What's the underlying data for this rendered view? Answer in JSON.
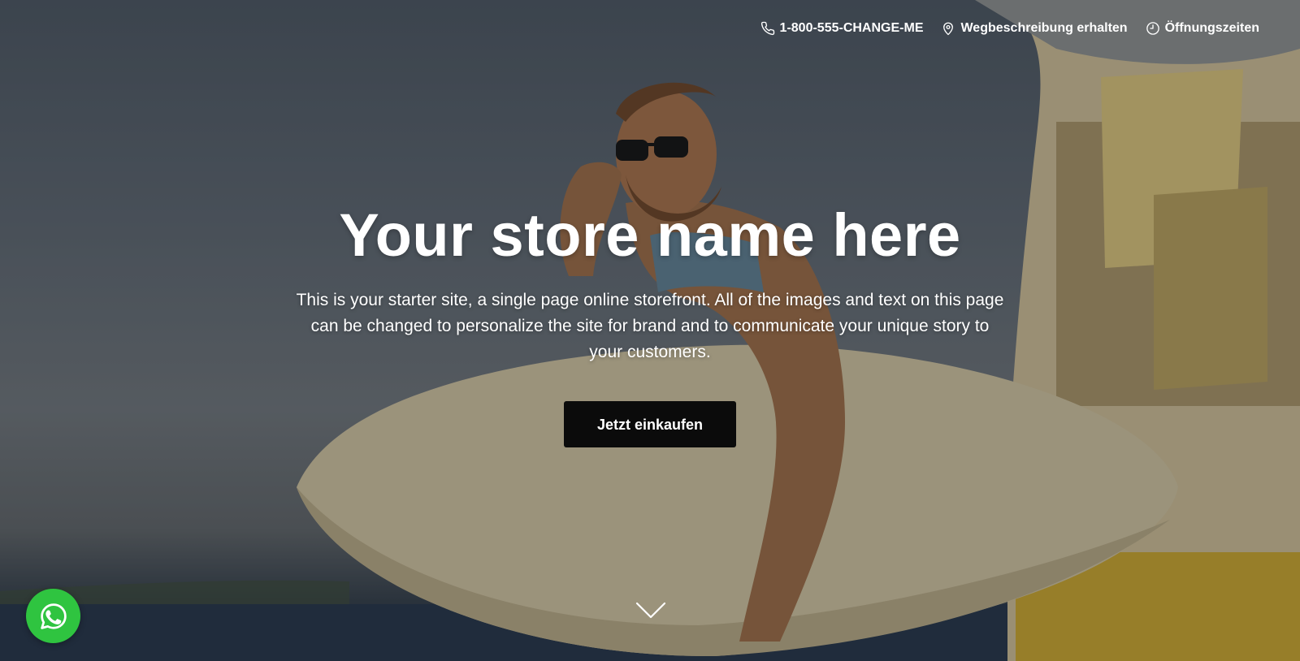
{
  "topbar": {
    "phone": "1-800-555-CHANGE-ME",
    "directions": "Wegbeschreibung erhalten",
    "hours": "Öffnungszeiten"
  },
  "hero": {
    "title": "Your store name here",
    "description": "This is your starter site, a single page online storefront. All of the images and text on this page can be changed to personalize the site for brand and to communicate your unique story to your customers.",
    "cta_label": "Jetzt einkaufen"
  },
  "icons": {
    "phone": "phone-icon",
    "directions": "location-pin-icon",
    "hours": "clock-icon",
    "scroll": "chevron-down-icon",
    "whatsapp": "whatsapp-icon"
  },
  "colors": {
    "button_bg": "#0b0b0b",
    "whatsapp_green": "#2fc440",
    "text": "#ffffff"
  }
}
